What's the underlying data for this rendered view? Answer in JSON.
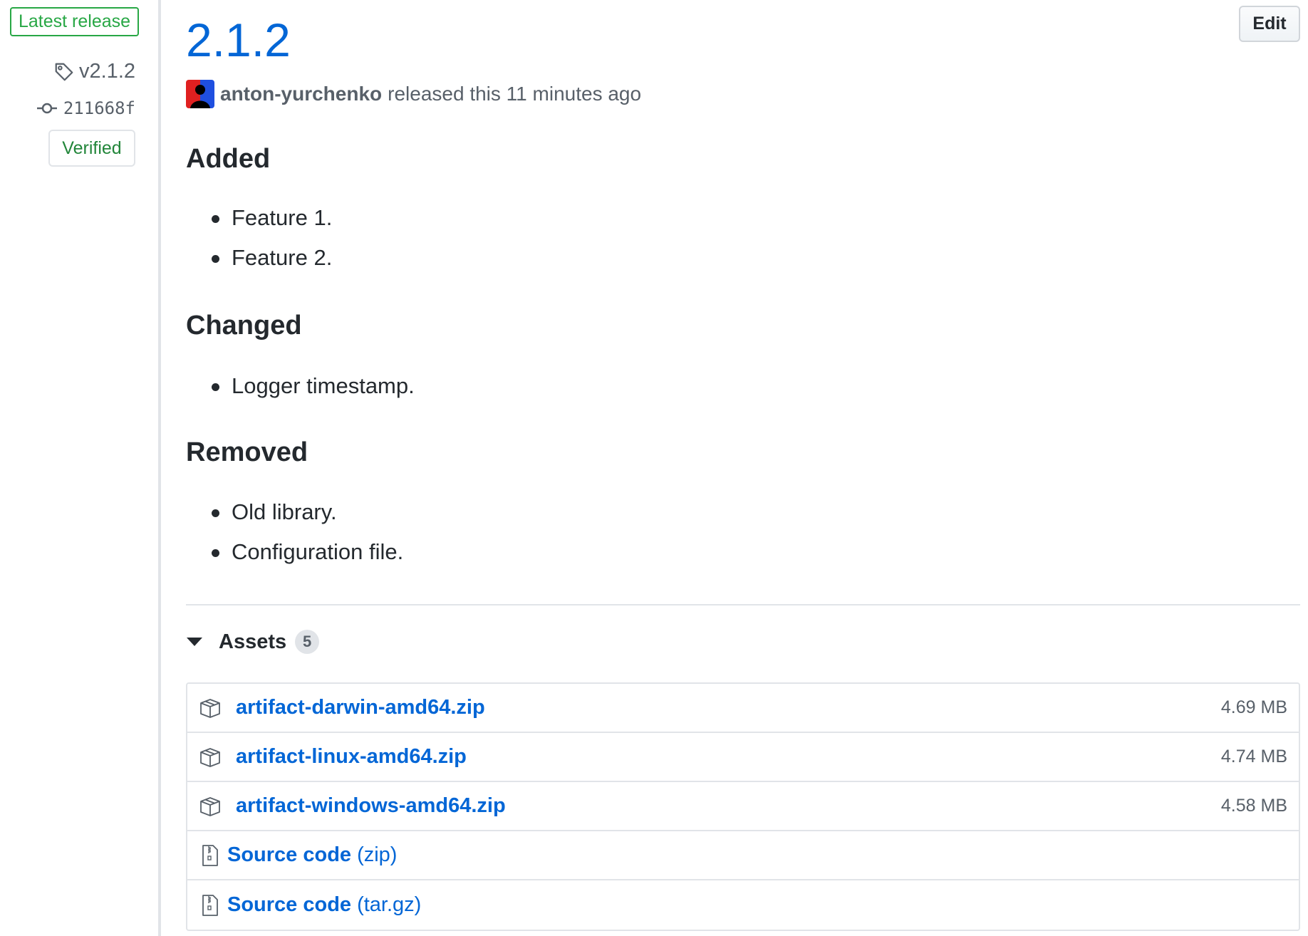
{
  "sidebar": {
    "latest_badge": "Latest release",
    "tag": "v2.1.2",
    "commit": "211668f",
    "verified": "Verified"
  },
  "release": {
    "title": "2.1.2",
    "edit_label": "Edit",
    "author": "anton-yurchenko",
    "released_text": "released this 11 minutes ago"
  },
  "notes": {
    "sections": [
      {
        "heading": "Added",
        "items": [
          "Feature 1.",
          "Feature 2."
        ]
      },
      {
        "heading": "Changed",
        "items": [
          "Logger timestamp."
        ]
      },
      {
        "heading": "Removed",
        "items": [
          "Old library.",
          "Configuration file."
        ]
      }
    ]
  },
  "assets": {
    "label": "Assets",
    "count": "5",
    "files": [
      {
        "name": "artifact-darwin-amd64.zip",
        "size": "4.69 MB"
      },
      {
        "name": "artifact-linux-amd64.zip",
        "size": "4.74 MB"
      },
      {
        "name": "artifact-windows-amd64.zip",
        "size": "4.58 MB"
      }
    ],
    "source": [
      {
        "name": "Source code",
        "format": "(zip)"
      },
      {
        "name": "Source code",
        "format": "(tar.gz)"
      }
    ]
  },
  "colors": {
    "link": "#0366d6",
    "latest_green": "#28a745",
    "verified_green": "#22863a",
    "muted": "#586069",
    "border": "#e1e4e8"
  }
}
